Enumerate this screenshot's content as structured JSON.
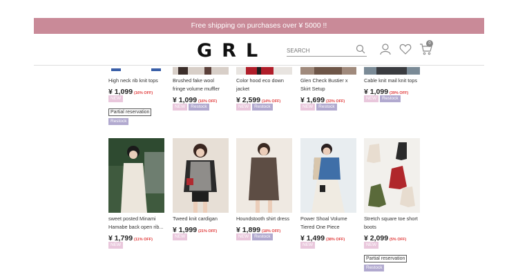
{
  "banner": {
    "text": "Free shipping on purchases over ¥ 5000 !!"
  },
  "header": {
    "logo": "GRL",
    "search_placeholder": "SEARCH",
    "cart_count": "0"
  },
  "row1": [
    {
      "name1": "High neck rib knit tops",
      "name2": "",
      "price": "¥ 1,099",
      "off": "(16% OFF)",
      "tags": [
        "NEW"
      ],
      "partial": "Partial reservation",
      "extra_tag": "Restock"
    },
    {
      "name1": "Brushed fake wool",
      "name2": "fringe volume muffler",
      "price": "¥ 1,099",
      "off": "(16% OFF)",
      "tags": [
        "NEW",
        "Restock"
      ]
    },
    {
      "name1": "Color hood eco down",
      "name2": "jacket",
      "price": "¥ 2,599",
      "off": "(14% OFF)",
      "tags": [
        "NEW",
        "Restock"
      ]
    },
    {
      "name1": "Glen Check Bustier x",
      "name2": "Skirt Setup",
      "price": "¥ 1,699",
      "off": "(33% OFF)",
      "tags": [
        "NEW",
        "Restock"
      ]
    },
    {
      "name1": "Cable knit mail knit tops",
      "name2": "",
      "price": "¥ 1,099",
      "off": "(39% OFF)",
      "tags": [
        "NEW",
        "Restock"
      ]
    }
  ],
  "row2": [
    {
      "name1": "sweet posted Minami",
      "name2": "Hamabe back open rib...",
      "price": "¥ 1,799",
      "off": "(11% OFF)",
      "tags": [
        "NEW"
      ]
    },
    {
      "name1": "Tweed knit cardigan",
      "name2": "",
      "price": "¥ 1,999",
      "off": "(21% OFF)",
      "tags": [
        "NEW"
      ]
    },
    {
      "name1": "Houndstooth shirt dress",
      "name2": "",
      "price": "¥ 1,899",
      "off": "(18% OFF)",
      "tags": [
        "NEW",
        "Restock"
      ]
    },
    {
      "name1": "Power Shoal Volume",
      "name2": "Tiered One Piece",
      "price": "¥ 1,499",
      "off": "(38% OFF)",
      "tags": [
        "NEW"
      ]
    },
    {
      "name1": "Stretch square toe short",
      "name2": "boots",
      "price": "¥ 2,099",
      "off": "(5% OFF)",
      "tags": [
        "NEW"
      ],
      "partial": "Partial reservation",
      "extra_tag": "Restock"
    }
  ],
  "colors": {
    "banner": "#c98a98",
    "new_tag": "#e9c7dc",
    "restock_tag": "#b1a9cf",
    "discount": "#e03a3a"
  }
}
